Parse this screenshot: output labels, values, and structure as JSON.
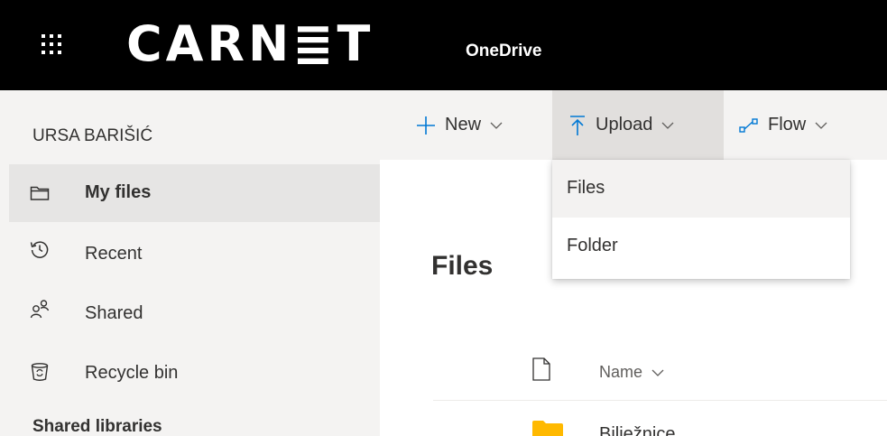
{
  "header": {
    "brand": "CARN≣T",
    "app_name": "OneDrive"
  },
  "sidebar": {
    "user_name": "URSA BARIŠIĆ",
    "items": [
      {
        "label": "My files",
        "icon": "folder-icon",
        "selected": true
      },
      {
        "label": "Recent",
        "icon": "clock-history-icon"
      },
      {
        "label": "Shared",
        "icon": "people-icon"
      },
      {
        "label": "Recycle bin",
        "icon": "recycle-bin-icon"
      }
    ],
    "section_title": "Shared libraries"
  },
  "commands": {
    "new_label": "New",
    "upload_label": "Upload",
    "flow_label": "Flow"
  },
  "upload_menu": {
    "items": [
      "Files",
      "Folder"
    ]
  },
  "main": {
    "title": "Files",
    "column_name": "Name",
    "rows": [
      {
        "name": "Bilježnice",
        "icon": "folder-icon"
      }
    ]
  },
  "colors": {
    "accent": "#0078d4",
    "folder": "#ffb900",
    "topbar": "#000000"
  }
}
